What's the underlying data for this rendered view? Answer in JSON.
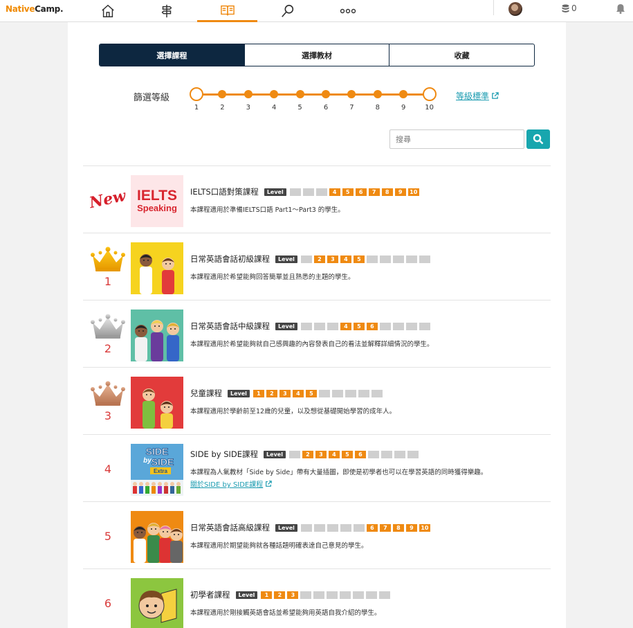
{
  "header": {
    "logo_a": "Native",
    "logo_b": "Camp.",
    "coins": "0"
  },
  "tabs": [
    "選擇課程",
    "選擇教材",
    "收藏"
  ],
  "filter": {
    "label": "篩選等級",
    "ticks": [
      "1",
      "2",
      "3",
      "4",
      "5",
      "6",
      "7",
      "8",
      "9",
      "10"
    ],
    "range": [
      1,
      10
    ],
    "level_standard_link": "等級標準"
  },
  "search": {
    "placeholder": "搜尋"
  },
  "level_badge": "Level",
  "courses": [
    {
      "rank": "",
      "rank_type": "new",
      "new_label": "New",
      "thumb": "ielts",
      "thumb_text_1": "IELTS",
      "thumb_text_2": "Speaking",
      "title": "IELTS口語對策課程",
      "levels": [
        4,
        5,
        6,
        7,
        8,
        9,
        10
      ],
      "desc": "本課程適用於準備IELTS口語 Part1～Part3 的學生。"
    },
    {
      "rank": "1",
      "rank_type": "gold",
      "thumb": "daily1",
      "title": "日常英語會話初級課程",
      "levels": [
        2,
        3,
        4,
        5
      ],
      "desc": "本課程適用於希望能夠回答簡單並且熟悉的主題的學生。"
    },
    {
      "rank": "2",
      "rank_type": "silver",
      "thumb": "daily2",
      "title": "日常英語會話中級課程",
      "levels": [
        4,
        5,
        6
      ],
      "desc": "本課程適用於希望能夠就自己感興趣的內容發表自己的看法並解釋詳細情況的學生。"
    },
    {
      "rank": "3",
      "rank_type": "bronze",
      "thumb": "kids",
      "title": "兒童課程",
      "levels": [
        1,
        2,
        3,
        4,
        5
      ],
      "desc": "本課程適用於學齡前至12歲的兒童，以及想從基礎開始學習的成年人。"
    },
    {
      "rank": "4",
      "rank_type": "none",
      "thumb": "side",
      "thumb_text_1": "SIDE",
      "thumb_text_2": "by",
      "thumb_text_3": "SIDE",
      "thumb_text_4": "Extra",
      "title": "SIDE by SIDE課程",
      "levels": [
        2,
        3,
        4,
        5,
        6
      ],
      "desc": "本課程為人氣教材「Side by Side」帶有大量插圖，即使是初學者也可以在學習英語的同時獲得樂趣。",
      "link": "關於SIDE by SIDE課程"
    },
    {
      "rank": "5",
      "rank_type": "none",
      "thumb": "daily3",
      "title": "日常英語會話高級課程",
      "levels": [
        6,
        7,
        8,
        9,
        10
      ],
      "desc": "本課程適用於期望能夠就各種話題明確表達自己意見的學生。"
    },
    {
      "rank": "6",
      "rank_type": "none",
      "thumb": "beginner",
      "title": "初學者課程",
      "levels": [
        1,
        2,
        3
      ],
      "desc": "本課程適用於剛接觸英語會話並希望能夠用英語自我介紹的學生。"
    }
  ],
  "colors": {
    "accent": "#ef8a12",
    "navy": "#0d2740",
    "teal": "#18a6ae",
    "rank": "#d93b3b"
  }
}
